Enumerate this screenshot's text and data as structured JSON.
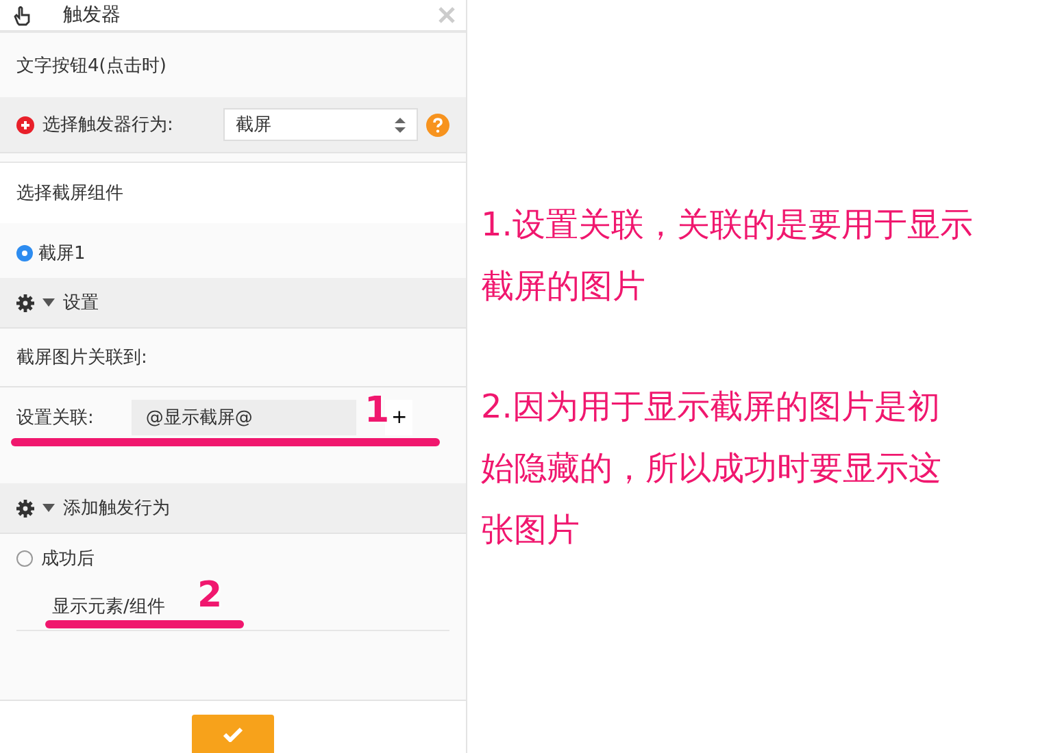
{
  "panel": {
    "title": "触发器",
    "source": "文字按钮4(点击时)",
    "behavior": {
      "label": "选择触发器行为:",
      "value": "截屏"
    },
    "component_heading": "选择截屏组件",
    "components": [
      {
        "label": "截屏1",
        "selected": true
      }
    ],
    "settings": {
      "title": "设置",
      "expanded": true,
      "subheading": "截屏图片关联到:",
      "link_label": "设置关联:",
      "link_value": "@显示截屏@",
      "add": "+"
    },
    "actions": {
      "title": "添加触发行为",
      "expanded": true,
      "events": [
        {
          "label": "成功后",
          "selected": false,
          "actions": [
            "显示元素/组件"
          ]
        }
      ]
    }
  },
  "annotations": {
    "markers": [
      {
        "number": "1"
      },
      {
        "number": "2"
      }
    ],
    "notes": [
      {
        "lines": [
          "1.设置关联，关联的是要用于显示",
          "截屏的图片"
        ]
      },
      {
        "lines": [
          "2.因为用于显示截屏的图片是初",
          "始隐藏的，所以成功时要显示这",
          "张图片"
        ]
      }
    ]
  }
}
